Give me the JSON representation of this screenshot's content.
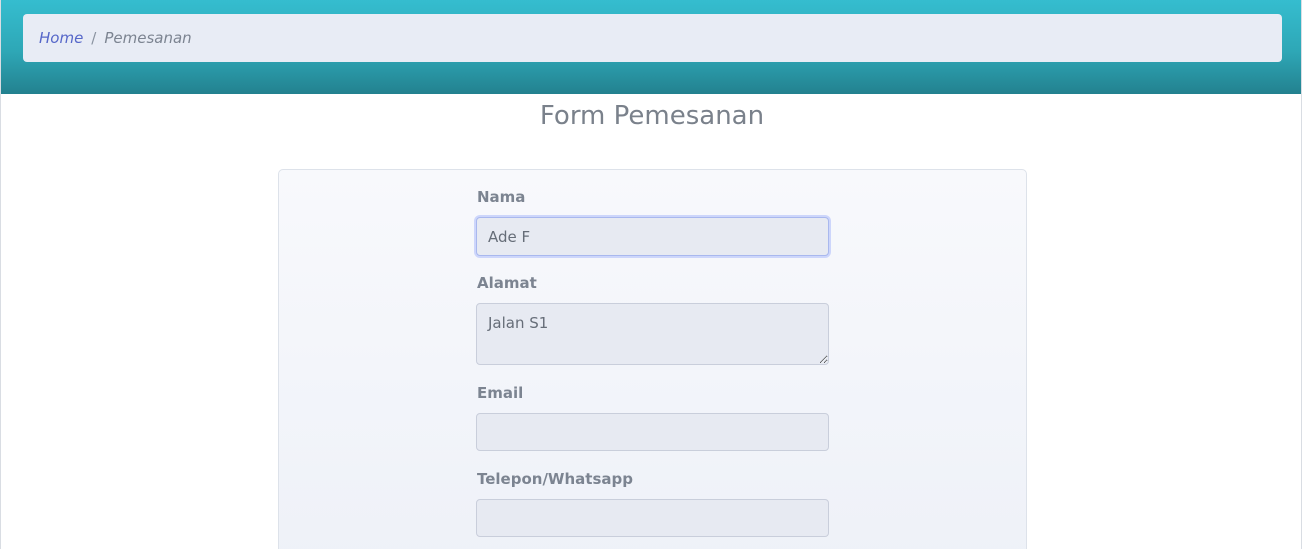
{
  "breadcrumb": {
    "home": "Home",
    "separator": "/",
    "current": "Pemesanan"
  },
  "page": {
    "title": "Form Pemesanan"
  },
  "form": {
    "nama": {
      "label": "Nama",
      "value": "Ade F"
    },
    "alamat": {
      "label": "Alamat",
      "value": "Jalan S1"
    },
    "email": {
      "label": "Email",
      "value": ""
    },
    "telepon": {
      "label": "Telepon/Whatsapp",
      "value": ""
    }
  }
}
